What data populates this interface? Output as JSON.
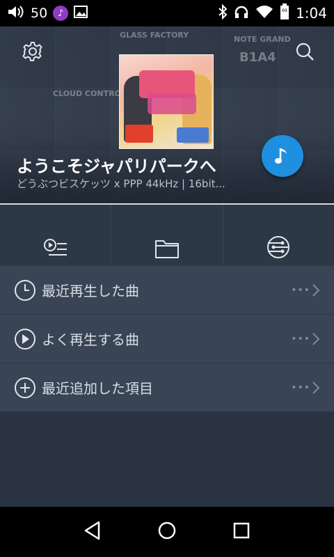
{
  "status_bar": {
    "volume_level": "50",
    "time": "1:04",
    "battery": "69",
    "icons": [
      "volume-icon",
      "music-note-icon",
      "image-icon",
      "bluetooth-icon",
      "headphones-icon",
      "wifi-icon",
      "battery-icon"
    ]
  },
  "header": {
    "now_playing": {
      "title": "ようこそジャパリパークへ",
      "subtitle": "どうぶつビスケッツ x PPP  44kHz | 16bit..."
    },
    "settings_icon": "gear-icon",
    "search_icon": "search-icon",
    "fab_icon": "music-note-icon",
    "background_tiles": [
      "GLASS FACTORY",
      "CLOUD CONTROL",
      "NOTE GRAND",
      "B1A4"
    ]
  },
  "tabs": [
    {
      "icon": "play-queue-icon"
    },
    {
      "icon": "folder-icon"
    },
    {
      "icon": "hub-icon"
    }
  ],
  "list": [
    {
      "label": "最近再生した曲",
      "icon": "clock-icon"
    },
    {
      "label": "よく再生する曲",
      "icon": "play-circle-icon"
    },
    {
      "label": "最近追加した項目",
      "icon": "add-circle-icon"
    }
  ],
  "colors": {
    "accent": "#1f8fe0",
    "list_bg": "#394555",
    "tab_bg": "#2d3846"
  }
}
